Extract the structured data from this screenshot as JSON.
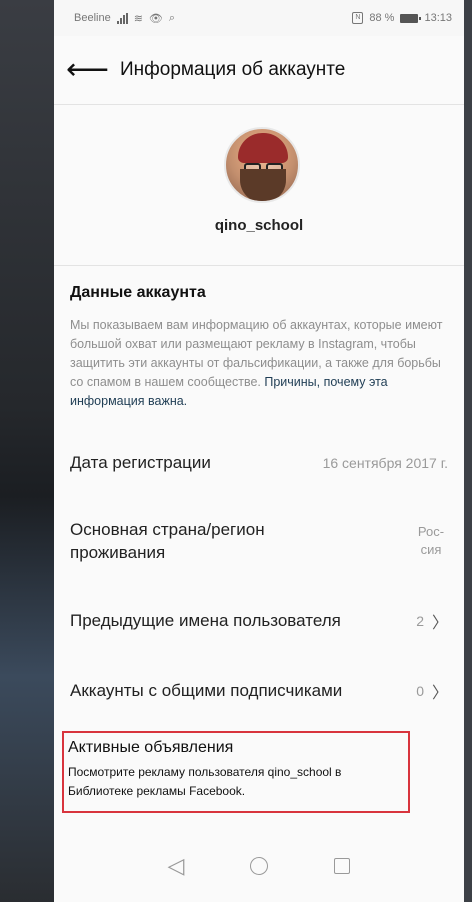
{
  "status_bar": {
    "carrier": "Beeline",
    "battery": "88 %",
    "time": "13:13"
  },
  "header": {
    "title": "Информация об аккаунте"
  },
  "profile": {
    "username": "qino_school"
  },
  "account_data": {
    "heading": "Данные аккаунта",
    "description": "Мы показываем вам информацию об аккаунтах, которые имеют большой охват или размещают рекламу в Instagram, чтобы защитить эти аккаунты от фальсификации, а также для борьбы со спамом в нашем сообществе.",
    "link": "Причины, почему эта информация важна."
  },
  "rows": [
    {
      "label": "Дата регистрации",
      "value": "16 сентября 2017 г."
    },
    {
      "label_line1": "Основная страна/регион",
      "label_line2": "проживания",
      "value_line1": "Рос-",
      "value_line2": "сия"
    },
    {
      "label": "Предыдущие имена пользователя",
      "value": "2"
    },
    {
      "label": "Аккаунты с общими подписчиками",
      "value": "0"
    }
  ],
  "active_ads": {
    "title": "Активные объявления",
    "subtitle_line1": "Посмотрите рекламу пользователя qino_school в",
    "subtitle_line2": "Библиотеке рекламы Facebook."
  },
  "icons": {
    "back": "arrow-left-icon",
    "chevron": "chevron-right-icon"
  },
  "colors": {
    "highlight_border": "#d8343d",
    "link": "#1f3d54"
  }
}
